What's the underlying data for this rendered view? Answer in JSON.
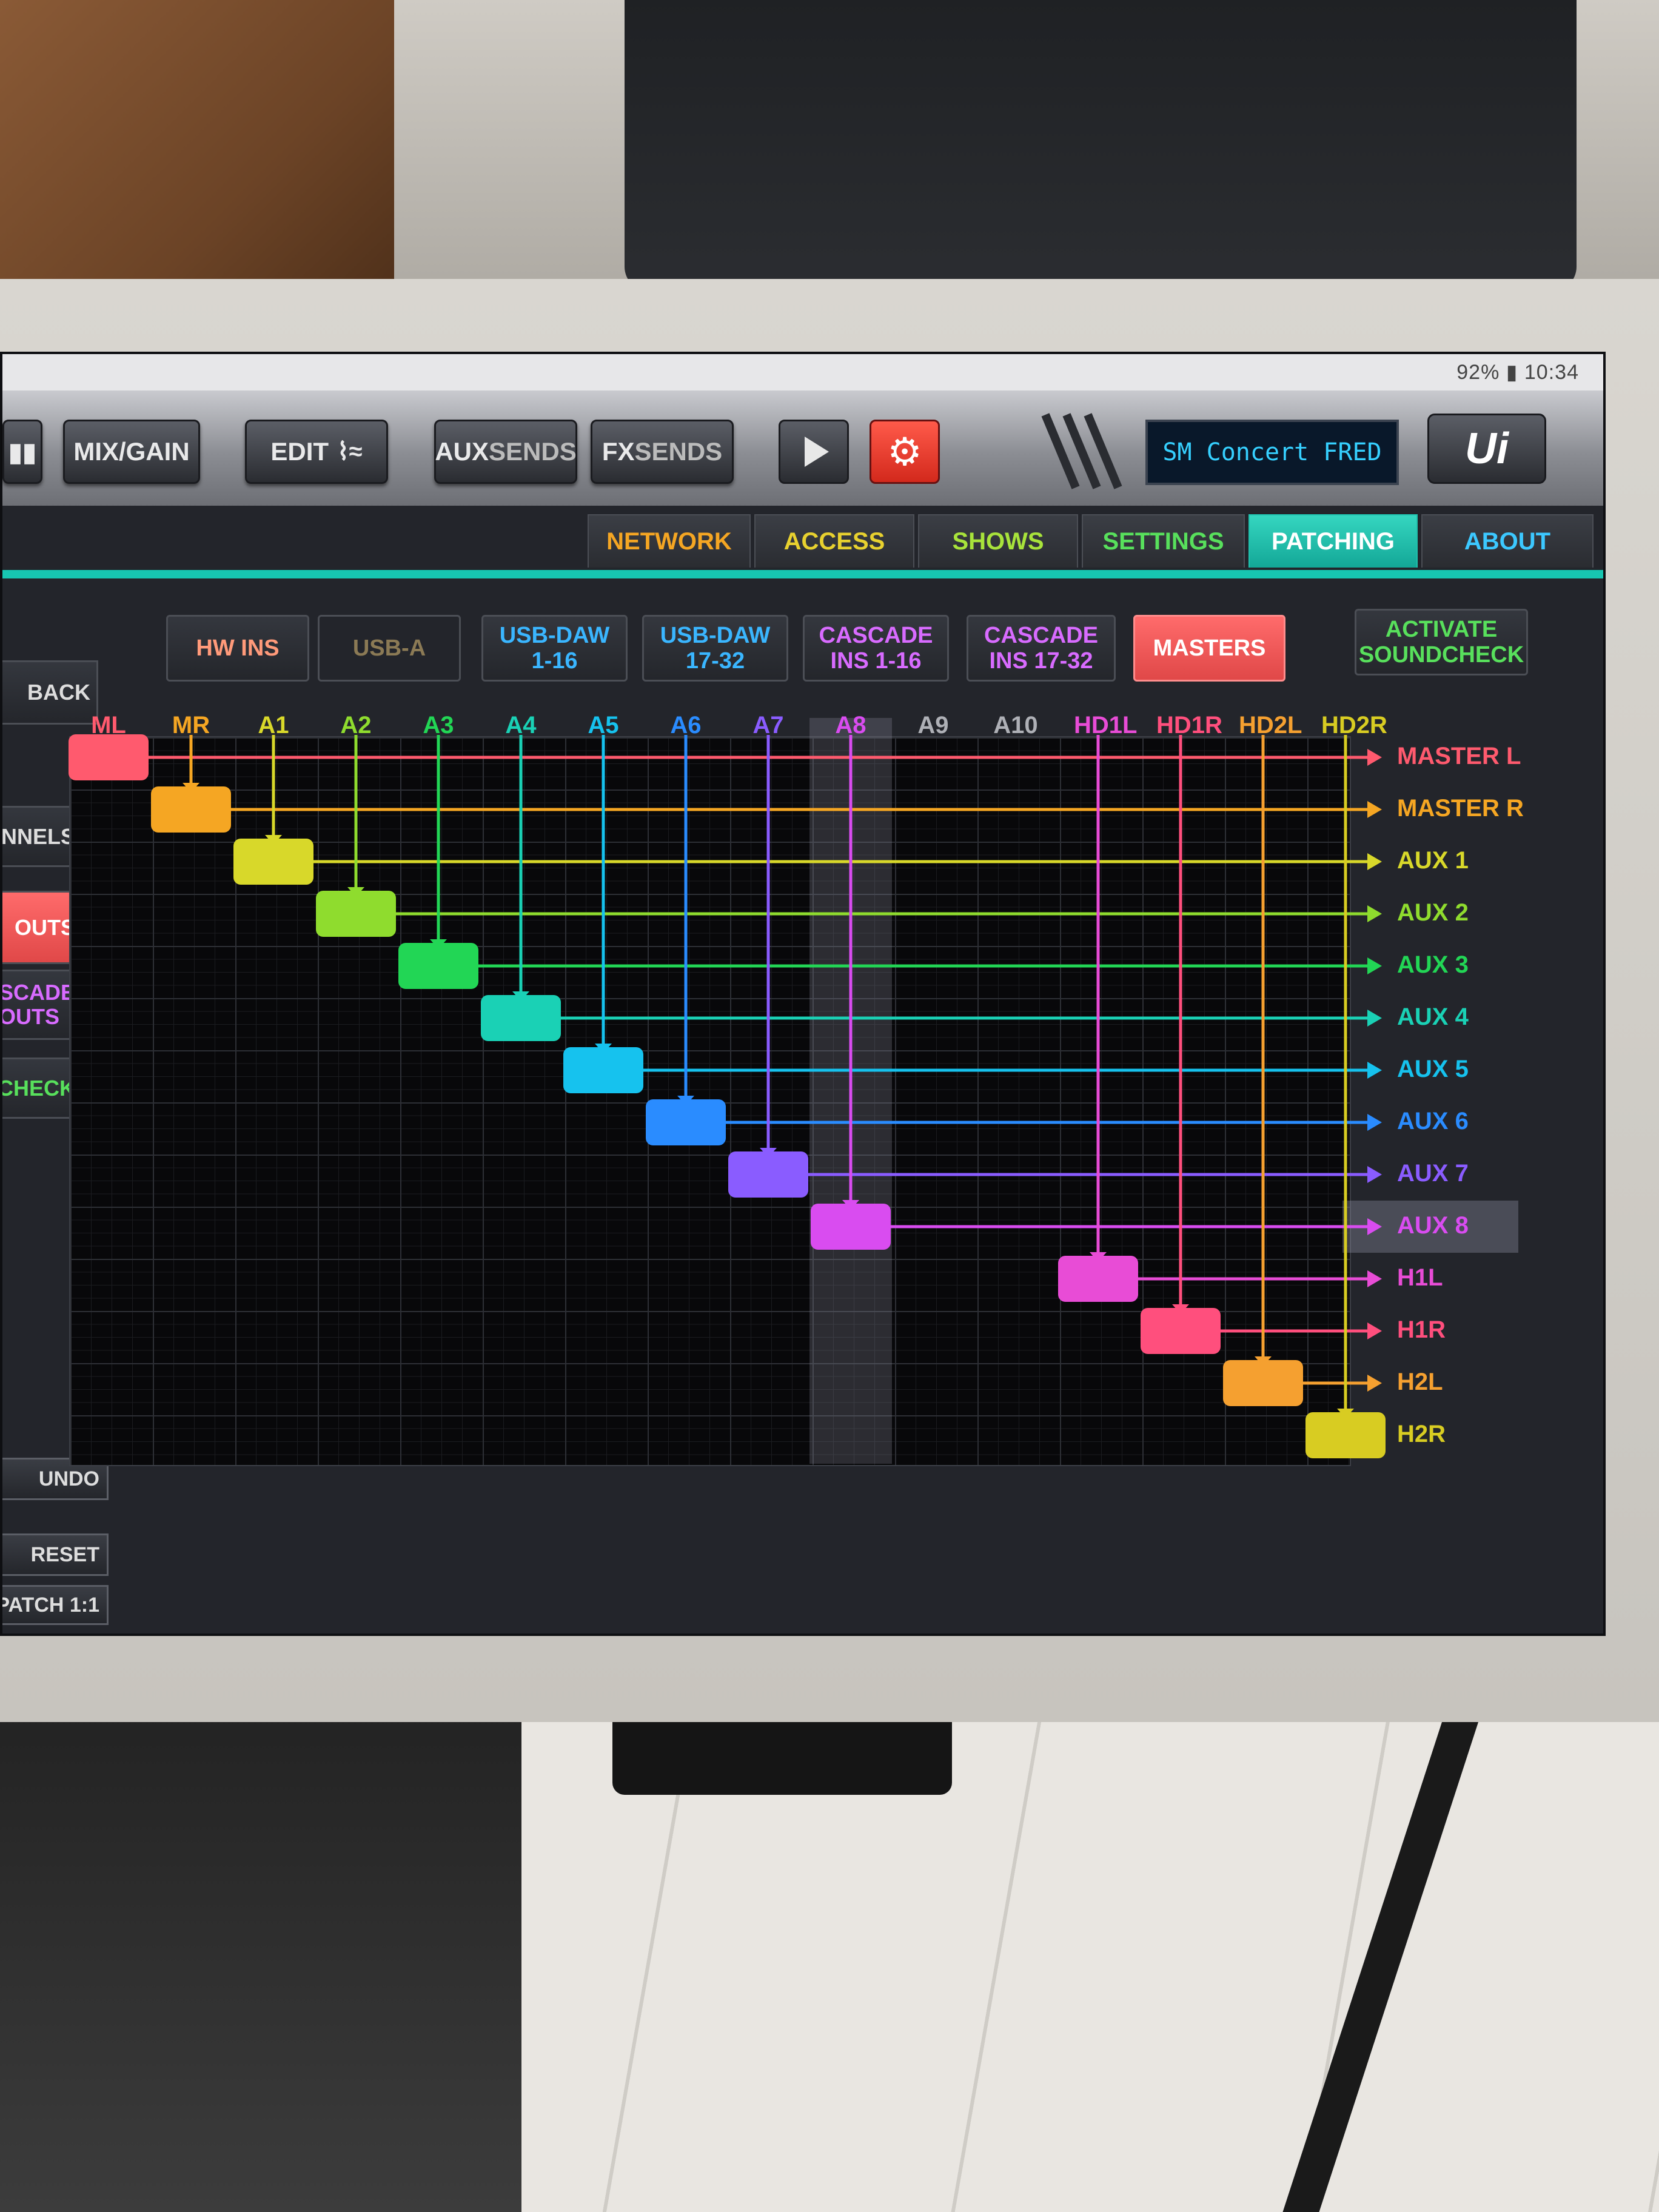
{
  "status_bar": {
    "text": "92% ▮ 10:34"
  },
  "toolbar": {
    "mix_gain": "MIX/GAIN",
    "edit": "EDIT",
    "aux_sends_a": "AUX",
    "aux_sends_b": "SENDS",
    "fx_sends_a": "FX",
    "fx_sends_b": "SENDS",
    "show_name": "SM Concert FRED",
    "logo": "Ui"
  },
  "tabs": [
    {
      "label": "NETWORK",
      "color": "#f5a623",
      "active": false
    },
    {
      "label": "ACCESS",
      "color": "#e8d12f",
      "active": false
    },
    {
      "label": "SHOWS",
      "color": "#a8e33b",
      "active": false
    },
    {
      "label": "SETTINGS",
      "color": "#58e05c",
      "active": false
    },
    {
      "label": "PATCHING",
      "color": "#ffffff",
      "active": true
    },
    {
      "label": "ABOUT",
      "color": "#3cc8ff",
      "active": false
    }
  ],
  "source_buttons": [
    {
      "label": "HW INS",
      "color": "#ff9a7a"
    },
    {
      "label": "USB-A",
      "color": "#8b7a55"
    },
    {
      "label": "USB-DAW\n1-16",
      "color": "#3ab6ff"
    },
    {
      "label": "USB-DAW\n17-32",
      "color": "#3ab6ff"
    },
    {
      "label": "CASCADE\nINS 1-16",
      "color": "#d86bff"
    },
    {
      "label": "CASCADE\nINS 17-32",
      "color": "#d86bff"
    },
    {
      "label": "MASTERS",
      "color": "#ffffff",
      "active": true
    },
    {
      "label": "ACTIVATE\nSOUNDCHECK",
      "color": "#58e05c"
    }
  ],
  "side_buttons": [
    {
      "label": "BACK",
      "color": "#dddddd"
    },
    {
      "label": "NNELS",
      "color": "#dddddd"
    },
    {
      "label": "OUTS",
      "color": "#ffffff",
      "active": true
    },
    {
      "label": "SCADE\nOUTS",
      "color": "#d86bff"
    },
    {
      "label": "NDCHECK",
      "color": "#58e05c"
    }
  ],
  "commands": {
    "undo": "UNDO",
    "reset": "RESET",
    "patch": "PATCH 1:1"
  },
  "columns": [
    "ML",
    "MR",
    "A1",
    "A2",
    "A3",
    "A4",
    "A5",
    "A6",
    "A7",
    "A8",
    "A9",
    "A10",
    "HD1L",
    "HD1R",
    "HD2L",
    "HD2R"
  ],
  "rows": [
    "MASTER L",
    "MASTER R",
    "AUX 1",
    "AUX 2",
    "AUX 3",
    "AUX 4",
    "AUX 5",
    "AUX 6",
    "AUX 7",
    "AUX 8",
    "H1L",
    "H1R",
    "H2L",
    "H2R"
  ],
  "highlighted_column": "A8",
  "highlighted_row": "AUX 8",
  "patches": [
    {
      "col": "ML",
      "row": "MASTER L",
      "color": "#ff5a6e"
    },
    {
      "col": "MR",
      "row": "MASTER R",
      "color": "#f5a623"
    },
    {
      "col": "A1",
      "row": "AUX 1",
      "color": "#d8d82a"
    },
    {
      "col": "A2",
      "row": "AUX 2",
      "color": "#8fdc2e"
    },
    {
      "col": "A3",
      "row": "AUX 3",
      "color": "#22d655"
    },
    {
      "col": "A4",
      "row": "AUX 4",
      "color": "#1ad1b5"
    },
    {
      "col": "A5",
      "row": "AUX 5",
      "color": "#16c2ee"
    },
    {
      "col": "A6",
      "row": "AUX 6",
      "color": "#2a8cff"
    },
    {
      "col": "A7",
      "row": "AUX 7",
      "color": "#8a5cff"
    },
    {
      "col": "A8",
      "row": "AUX 8",
      "color": "#d94cf0"
    },
    {
      "col": "HD1L",
      "row": "H1L",
      "color": "#e84cd6"
    },
    {
      "col": "HD1R",
      "row": "H1R",
      "color": "#ff4f7d"
    },
    {
      "col": "HD2L",
      "row": "H2L",
      "color": "#f5a030"
    },
    {
      "col": "HD2R",
      "row": "H2R",
      "color": "#d8cc22"
    }
  ]
}
